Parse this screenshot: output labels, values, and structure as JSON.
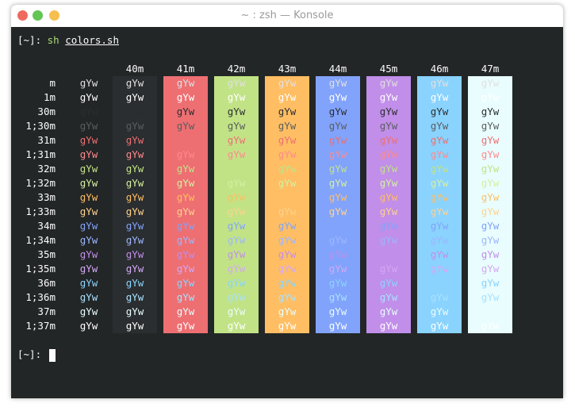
{
  "window": {
    "title": "~ : zsh — Konsole"
  },
  "prompt": {
    "text": "[~]: ",
    "program": "sh",
    "argument": "colors.sh"
  },
  "prompt2": {
    "text": "[~]: "
  },
  "sample_text": "gYw",
  "bg_headers": [
    "40m",
    "41m",
    "42m",
    "43m",
    "44m",
    "45m",
    "46m",
    "47m"
  ],
  "bg_colors": [
    "#2b2e30",
    "#ed6f72",
    "#c1e386",
    "#ffbe63",
    "#82a3fb",
    "#c18ee9",
    "#8ad3fe",
    "#e9fdfe"
  ],
  "row_labels": [
    "m",
    "1m",
    "30m",
    "1;30m",
    "31m",
    "1;31m",
    "32m",
    "1;32m",
    "33m",
    "1;33m",
    "34m",
    "1;34m",
    "35m",
    "1;35m",
    "36m",
    "1;36m",
    "37m",
    "1;37m"
  ],
  "fg_colors": [
    "#e0e0e0",
    "#ffffff",
    "#2a2d2f",
    "#5a5d5f",
    "#ed6f72",
    "#ff8a8c",
    "#c1e386",
    "#d4f0a0",
    "#ffbe63",
    "#ffd28f",
    "#82a3fb",
    "#9db6ff",
    "#c18ee9",
    "#d4a8f5",
    "#8ad3fe",
    "#a8e1ff",
    "#e9fdfe",
    "#ffffff"
  ],
  "default_fg": "#e0e0e0"
}
